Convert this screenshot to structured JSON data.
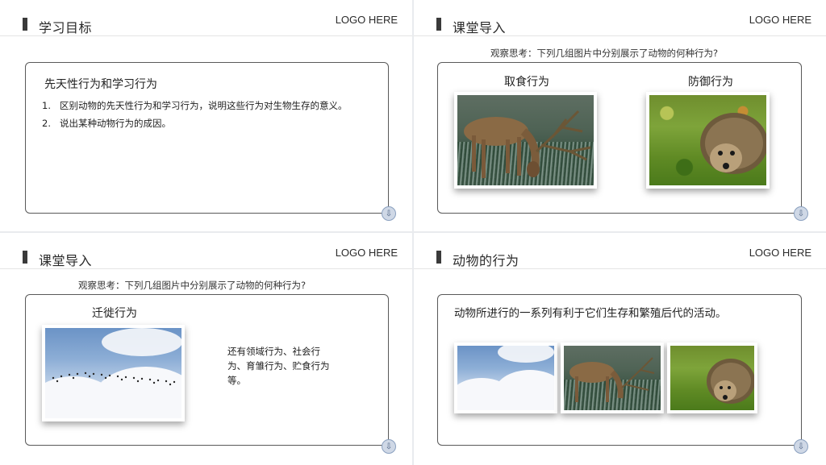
{
  "slides": [
    {
      "header": {
        "title": "学习目标",
        "logo": "LOGO HERE"
      },
      "objectives": {
        "title": "先天性行为和学习行为",
        "items": [
          {
            "num": "1.",
            "text": "区别动物的先天性行为和学习行为，说明这些行为对生物生存的意义。"
          },
          {
            "num": "2.",
            "text": "说出某种动物行为的成因。"
          }
        ]
      }
    },
    {
      "header": {
        "title": "课堂导入",
        "logo": "LOGO HERE"
      },
      "question": "观察思考：下列几组图片中分别展示了动物的何种行为?",
      "captions": [
        "取食行为",
        "防御行为"
      ]
    },
    {
      "header": {
        "title": "课堂导入",
        "logo": "LOGO HERE"
      },
      "question": "观察思考：下列几组图片中分别展示了动物的何种行为?",
      "caption": "迁徙行为",
      "extra": "还有领域行为、社会行为、育雏行为、贮食行为等。"
    },
    {
      "header": {
        "title": "动物的行为",
        "logo": "LOGO HERE"
      },
      "definition": "动物所进行的一系列有利于它们生存和繁殖后代的活动。"
    }
  ],
  "icons": {
    "header_marker": "title-bar-marker",
    "corner_badge": "page-badge-icon"
  },
  "colors": {
    "background": "#e9ebee",
    "slide": "#ffffff",
    "frame_border": "#595959",
    "header_marker": "#3a3a3a"
  }
}
